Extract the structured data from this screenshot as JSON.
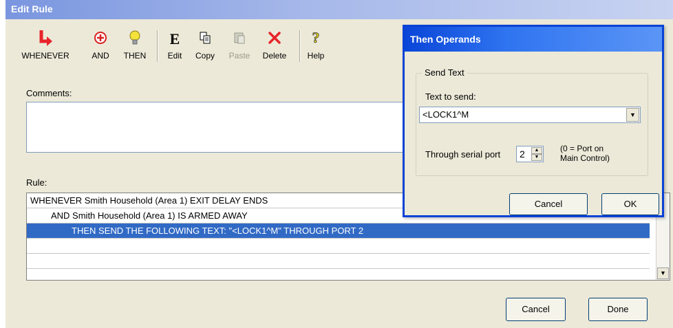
{
  "edit_rule": {
    "title": "Edit Rule",
    "toolbar": [
      {
        "label": "WHENEVER",
        "icon": "whenever-arrow-icon",
        "enabled": true
      },
      {
        "label": "AND",
        "icon": "plus-circle-icon",
        "enabled": true
      },
      {
        "label": "THEN",
        "icon": "lightbulb-icon",
        "enabled": true
      },
      {
        "label": "Edit",
        "icon": "edit-e-icon",
        "enabled": true
      },
      {
        "label": "Copy",
        "icon": "copy-icon",
        "enabled": true
      },
      {
        "label": "Paste",
        "icon": "paste-icon",
        "enabled": false
      },
      {
        "label": "Delete",
        "icon": "delete-x-icon",
        "enabled": true
      },
      {
        "label": "Help",
        "icon": "help-question-icon",
        "enabled": true
      }
    ],
    "comments_label": "Comments:",
    "comments_value": "",
    "rule_label": "Rule:",
    "rule_rows": [
      {
        "text": "WHENEVER  Smith Household (Area 1) EXIT DELAY ENDS",
        "indent": 0,
        "selected": false
      },
      {
        "text": "AND Smith Household (Area 1) IS ARMED AWAY",
        "indent": 1,
        "selected": false
      },
      {
        "text": "THEN SEND THE FOLLOWING TEXT: \"<LOCK1^M\" THROUGH PORT 2",
        "indent": 2,
        "selected": true
      },
      {
        "text": "",
        "indent": 0,
        "selected": false
      },
      {
        "text": "",
        "indent": 0,
        "selected": false
      }
    ],
    "cancel_label": "Cancel",
    "done_label": "Done"
  },
  "then_operands": {
    "title": "Then Operands",
    "group_label": "Send Text",
    "text_to_send_label": "Text to send:",
    "text_to_send_value": "<LOCK1^M",
    "serial_port_label": "Through serial port",
    "serial_port_value": "2",
    "port_note_line1": "(0 = Port on",
    "port_note_line2": "Main Control)",
    "cancel_label": "Cancel",
    "ok_label": "OK"
  },
  "colors": {
    "selection": "#316ac5",
    "dialog_title": "#0a45d8",
    "delete_icon": "#e8232a",
    "whenever_icon": "#e8232a"
  }
}
